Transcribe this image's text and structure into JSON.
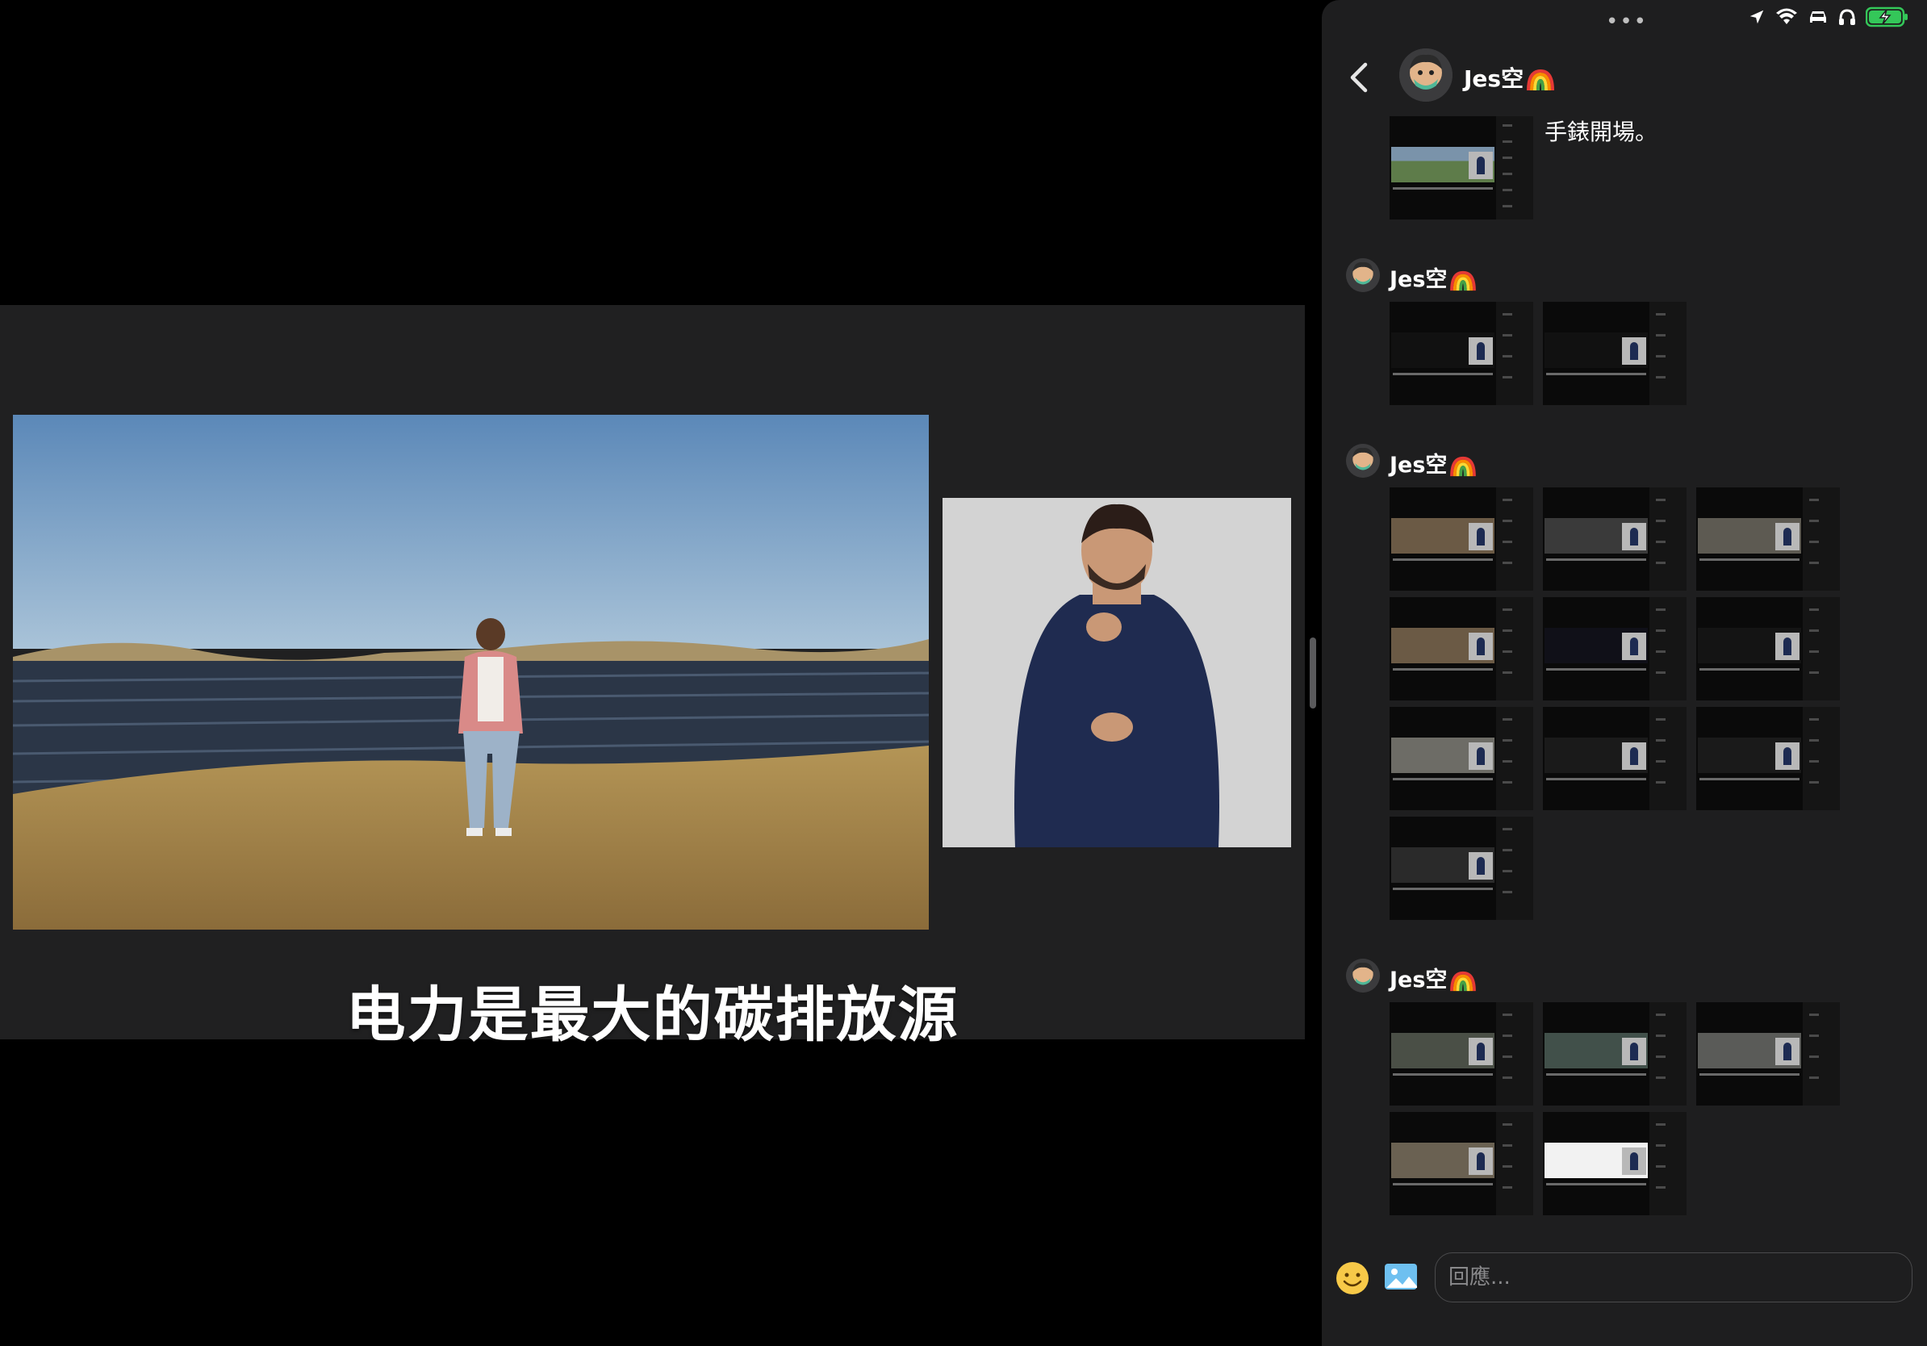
{
  "video": {
    "subtitle": "电力是最大的碳排放源"
  },
  "chat": {
    "contact_name": "Jes空",
    "contact_emoji": "rainbow",
    "first_message_text": "手錶開場。",
    "groups": [
      {
        "sender": "Jes空",
        "count": 1
      },
      {
        "sender": "Jes空",
        "count": 2
      },
      {
        "sender": "Jes空",
        "count": 10
      },
      {
        "sender": "Jes空",
        "count": 5
      }
    ],
    "composer": {
      "placeholder": "回應..."
    }
  },
  "status": {
    "icons": [
      "location-icon",
      "wifi-icon",
      "car-icon",
      "headphones-icon",
      "battery-charging-icon"
    ],
    "battery_color": "#34c759"
  },
  "colors": {
    "panel_bg": "#1e1e1f",
    "video_band_bg": "#202021"
  }
}
